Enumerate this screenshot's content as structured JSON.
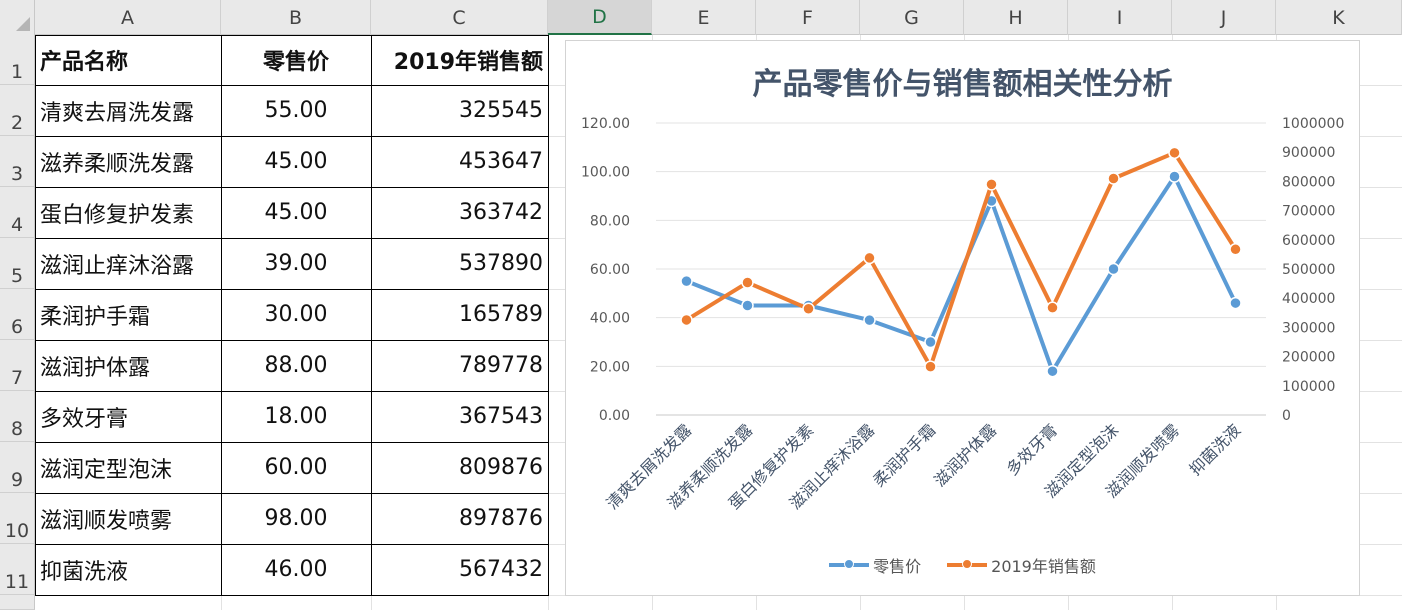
{
  "columns": [
    "A",
    "B",
    "C",
    "D",
    "E",
    "F",
    "G",
    "H",
    "I",
    "J",
    "K"
  ],
  "selected_column": "D",
  "rows": [
    "1",
    "2",
    "3",
    "4",
    "5",
    "6",
    "7",
    "8",
    "9",
    "10",
    "11"
  ],
  "table": {
    "headers": [
      "产品名称",
      "零售价",
      "2019年销售额"
    ],
    "rows": [
      [
        "清爽去屑洗发露",
        "55.00",
        "325545"
      ],
      [
        "滋养柔顺洗发露",
        "45.00",
        "453647"
      ],
      [
        "蛋白修复护发素",
        "45.00",
        "363742"
      ],
      [
        "滋润止痒沐浴露",
        "39.00",
        "537890"
      ],
      [
        "柔润护手霜",
        "30.00",
        "165789"
      ],
      [
        "滋润护体露",
        "88.00",
        "789778"
      ],
      [
        "多效牙膏",
        "18.00",
        "367543"
      ],
      [
        "滋润定型泡沫",
        "60.00",
        "809876"
      ],
      [
        "滋润顺发喷雾",
        "98.00",
        "897876"
      ],
      [
        "抑菌洗液",
        "46.00",
        "567432"
      ]
    ]
  },
  "chart_data": {
    "type": "line",
    "title": "产品零售价与销售额相关性分析",
    "categories": [
      "清爽去屑洗发露",
      "滋养柔顺洗发露",
      "蛋白修复护发素",
      "滋润止痒沐浴露",
      "柔润护手霜",
      "滋润护体露",
      "多效牙膏",
      "滋润定型泡沫",
      "滋润顺发喷雾",
      "抑菌洗液"
    ],
    "series": [
      {
        "name": "零售价",
        "axis": "left",
        "color": "#5b9bd5",
        "values": [
          55,
          45,
          45,
          39,
          30,
          88,
          18,
          60,
          98,
          46
        ]
      },
      {
        "name": "2019年销售额",
        "axis": "right",
        "color": "#ed7d31",
        "values": [
          325545,
          453647,
          363742,
          537890,
          165789,
          789778,
          367543,
          809876,
          897876,
          567432
        ]
      }
    ],
    "y_left": {
      "min": 0,
      "max": 120,
      "ticks": [
        "0.00",
        "20.00",
        "40.00",
        "60.00",
        "80.00",
        "100.00",
        "120.00"
      ]
    },
    "y_right": {
      "min": 0,
      "max": 1000000,
      "ticks": [
        "0",
        "100000",
        "200000",
        "300000",
        "400000",
        "500000",
        "600000",
        "700000",
        "800000",
        "900000",
        "1000000"
      ]
    },
    "grid": true,
    "legend": "bottom"
  }
}
